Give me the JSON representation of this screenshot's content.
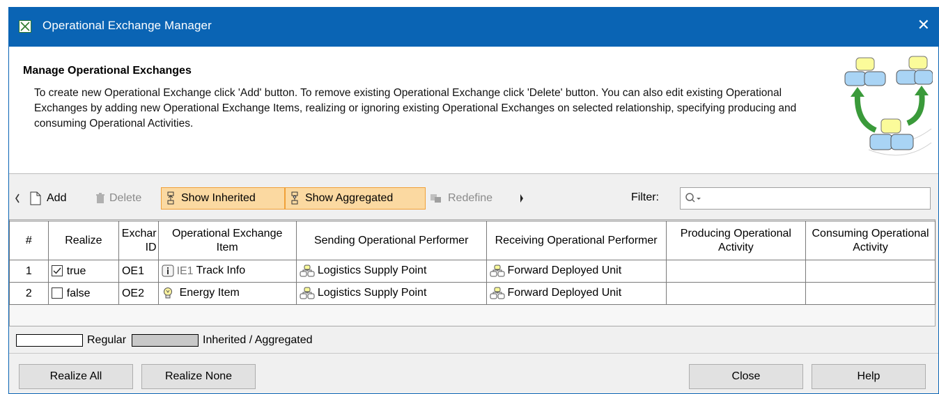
{
  "window": {
    "title": "Operational Exchange Manager",
    "close_glyph": "✕"
  },
  "header": {
    "heading": "Manage Operational Exchanges",
    "description": "To create new Operational Exchange click 'Add' button. To remove existing Operational Exchange click 'Delete' button. You can also edit existing Operational Exchanges by adding new Operational Exchange Items, realizing or ignoring existing Operational Exchanges on selected relationship, specifying producing and consuming Operational Activities."
  },
  "toolbar": {
    "add_label": "Add",
    "delete_label": "Delete",
    "show_inherited_label": "Show Inherited",
    "show_aggregated_label": "Show Aggregated",
    "redefine_label": "Redefine",
    "filter_label": "Filter:",
    "filter_value": ""
  },
  "table": {
    "columns": [
      "#",
      "Realize",
      "Exchar ID",
      "Operational Exchange Item",
      "Sending Operational Performer",
      "Receiving Operational Performer",
      "Producing Operational Activity",
      "Consuming Operational Activity"
    ],
    "rows": [
      {
        "num": "1",
        "realize": "true",
        "checked": true,
        "id": "OE1",
        "item_prefix": "IE1",
        "item": "Track Info",
        "item_icon": "information-item-icon",
        "sending": "Logistics Supply Point",
        "receiving": "Forward Deployed Unit",
        "producing": "",
        "consuming": ""
      },
      {
        "num": "2",
        "realize": "false",
        "checked": false,
        "id": "OE2",
        "item_prefix": "",
        "item": "Energy Item",
        "item_icon": "energy-item-icon",
        "sending": "Logistics Supply Point",
        "receiving": "Forward Deployed Unit",
        "producing": "",
        "consuming": ""
      }
    ]
  },
  "legend": {
    "regular": "Regular",
    "inherited": "Inherited / Aggregated",
    "regular_color": "#ffffff",
    "inherited_color": "#c8c8c8"
  },
  "buttons": {
    "realize_all": "Realize All",
    "realize_none": "Realize None",
    "close": "Close",
    "help": "Help"
  },
  "colors": {
    "titlebar": "#0a64b4",
    "toggle_bg": "#fbd9a1",
    "toggle_border": "#f0a038"
  }
}
